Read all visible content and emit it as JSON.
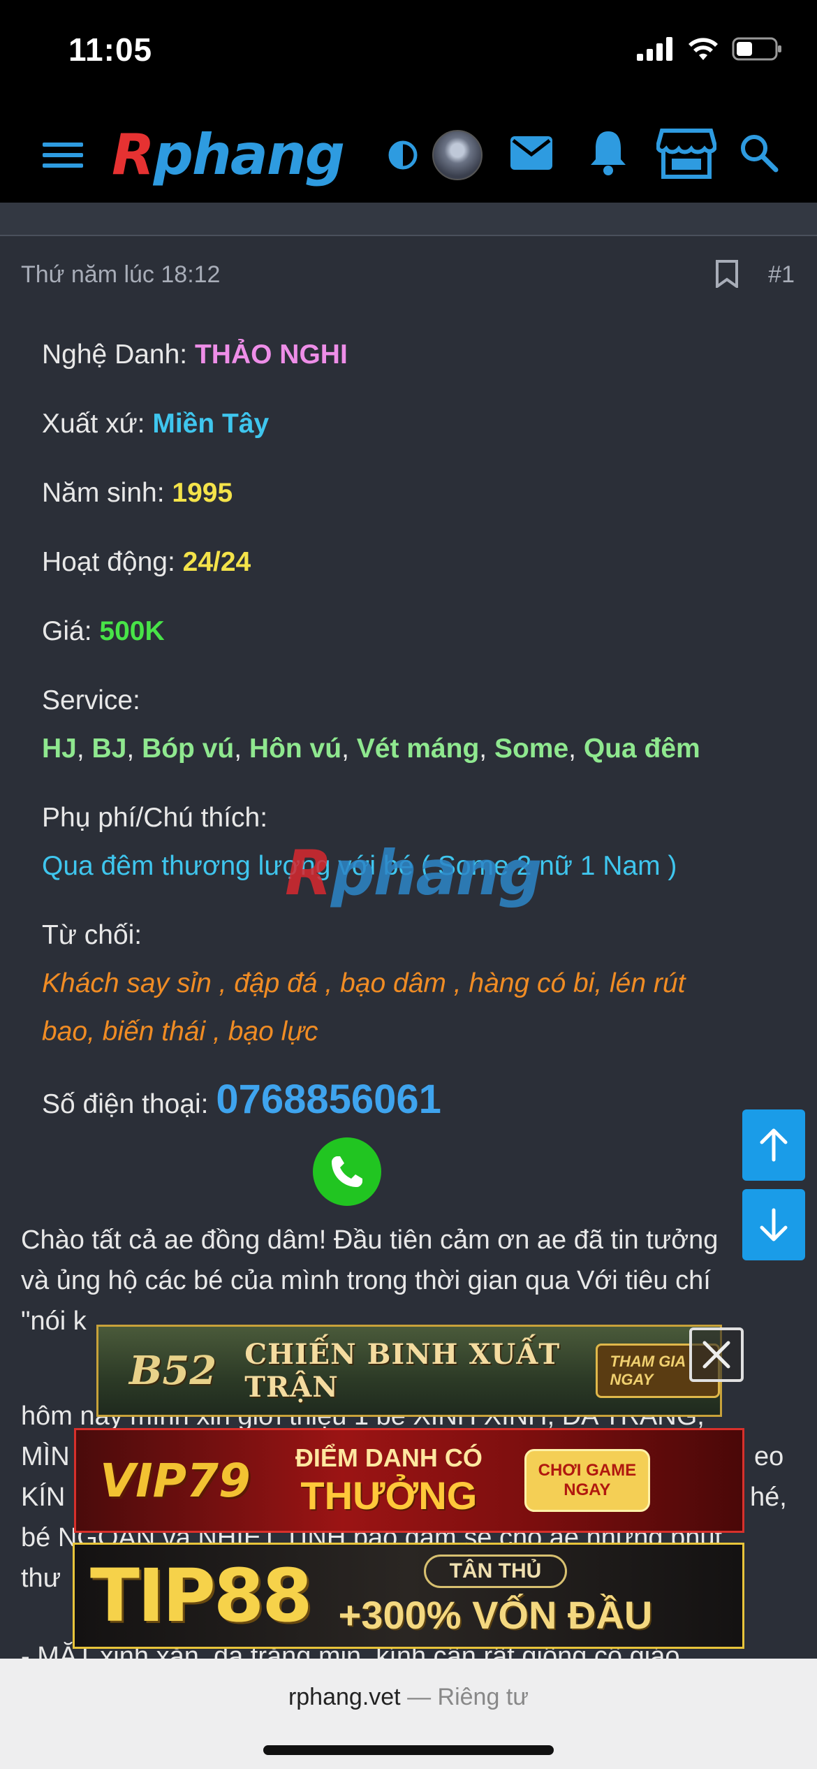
{
  "status_bar": {
    "time": "11:05"
  },
  "nav": {
    "logo_r": "R",
    "logo_rest": "phang"
  },
  "post": {
    "meta": "Thứ năm lúc 18:12",
    "number": "#1",
    "stage_name_label": "Nghệ Danh: ",
    "stage_name": "THẢO NGHI",
    "origin_label": "Xuất xứ: ",
    "origin": "Miền Tây",
    "birth_label": "Năm sinh: ",
    "birth": "1995",
    "active_label": "Hoạt động: ",
    "active": "24/24",
    "price_label": "Giá: ",
    "price": "500K",
    "service_label": "Service:",
    "services": [
      "HJ",
      "BJ",
      "Bóp vú",
      "Hôn vú",
      "Vét máng",
      "Some",
      "Qua đêm"
    ],
    "services_sep": ", ",
    "extra_label": "Phụ phí/Chú thích:",
    "extra": "Qua đêm thương lượng với bé ( Some 2 nữ 1 Nam )",
    "reject_label": "Từ chối:",
    "reject_line1": "Khách say sỉn , đập đá , bạo dâm , hàng có bi, lén rút",
    "reject_line2": "bao, biến thái , bạo lực",
    "phone_label": "Số điện thoại: ",
    "phone": "0768856061"
  },
  "watermark": {
    "r": "R",
    "rest": "phang"
  },
  "body_text": [
    "Chào tất cả ae đồng dâm! Đầu tiên cảm ơn ae đã tin tưởng",
    "và ủng hộ các bé của mình trong thời gian qua Với tiêu chí",
    "\"nói k",
    "hôm nay mình xin giới thiệu 1 bé XINH XINH, DA TRẮNG,",
    "MÌN",
    "eo",
    "KÍN",
    "hé,",
    "bé NGOAN và NHIỆT TÌNH bao đảm sẽ cho ae những phút",
    "thư",
    "- MẶT xinh xắn, da trắng mịn, kính cận rất giống cô giáo"
  ],
  "ads": {
    "b52_logo": "B52",
    "b52_text": "CHIẾN BINH XUẤT TRẬN",
    "b52_cta": "THAM GIA NGAY",
    "vip_logo": "VIP79",
    "vip_text1": "ĐIỂM DANH CÓ",
    "vip_text2": "THƯỞNG",
    "vip_cta": "CHƠI GAME NGAY",
    "tip_logo": "TIP88",
    "tip_badge": "TÂN THỦ",
    "tip_text": "+300% VỐN ĐẦU"
  },
  "bottom": {
    "domain": "rphang.vet",
    "sep": " — ",
    "private": "Riêng tư"
  },
  "colors": {
    "accent": "#1a9ce8",
    "pink": "#ee8ee8",
    "cyan": "#3fc6ee",
    "yellow": "#f4e34a",
    "green": "#48e448",
    "orange": "#f08c24"
  }
}
